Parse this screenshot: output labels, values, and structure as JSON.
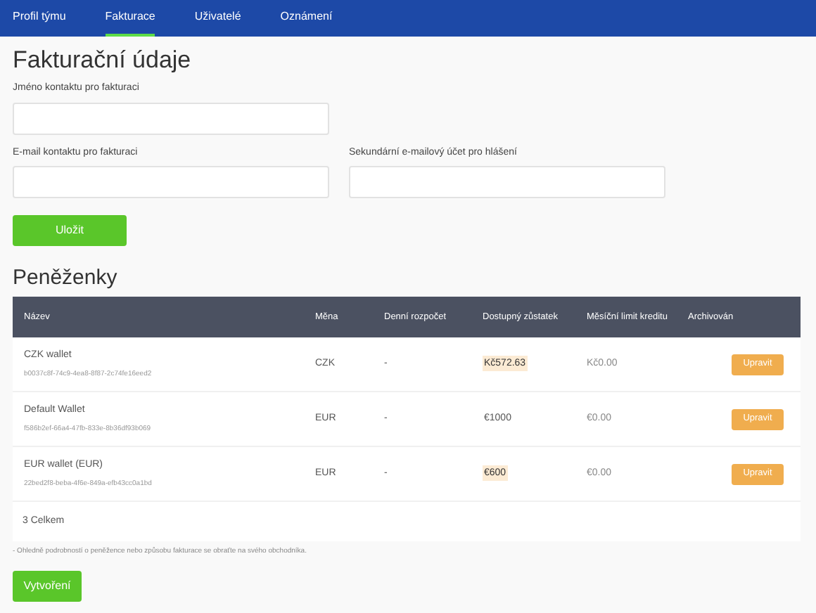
{
  "tabs": [
    {
      "label": "Profil týmu",
      "selected": false
    },
    {
      "label": "Fakturace",
      "selected": true
    },
    {
      "label": "Uživatelé",
      "selected": false
    },
    {
      "label": "Oznámení",
      "selected": false
    }
  ],
  "billing": {
    "title": "Fakturační údaje",
    "fields": [
      {
        "label": "Jméno kontaktu pro fakturaci"
      },
      {
        "label": "E-mail kontaktu pro fakturaci"
      },
      {
        "label": "Sekundární e-mailový účet pro hlášení"
      }
    ],
    "save_button": "Uložit"
  },
  "wallets": {
    "title": "Peněženky",
    "columns": [
      "Název",
      "Měna",
      "Denní rozpočet",
      "Dostupný zůstatek",
      "Měsíční limit kreditu",
      "Archivován"
    ],
    "rows": [
      {
        "name": "CZK wallet",
        "id": "b0037c8f-74c9-4ea8-8f87-2c74fe16eed2",
        "currency": "CZK",
        "daily_budget": "-",
        "balance": "Kč572.63",
        "balance_highlighted": true,
        "credit_limit": "Kč0.00",
        "action": "Upravit"
      },
      {
        "name": "Default Wallet",
        "id": "f586b2ef-66a4-47fb-833e-8b36df93b069",
        "currency": "EUR",
        "daily_budget": "-",
        "balance": "€1000",
        "balance_highlighted": false,
        "credit_limit": "€0.00",
        "action": "Upravit"
      },
      {
        "name": "EUR wallet (EUR)",
        "id": "22bed2f8-beba-4f6e-849a-efb43cc0a1bd",
        "currency": "EUR",
        "daily_budget": "-",
        "balance": "€600",
        "balance_highlighted": true,
        "credit_limit": "€0.00",
        "action": "Upravit"
      }
    ],
    "total": "3 Celkem",
    "note": "- Ohledně podrobností o peněžence nebo způsobu fakturace se obraťte na svého obchodníka.",
    "create_button": "Vytvoření"
  }
}
